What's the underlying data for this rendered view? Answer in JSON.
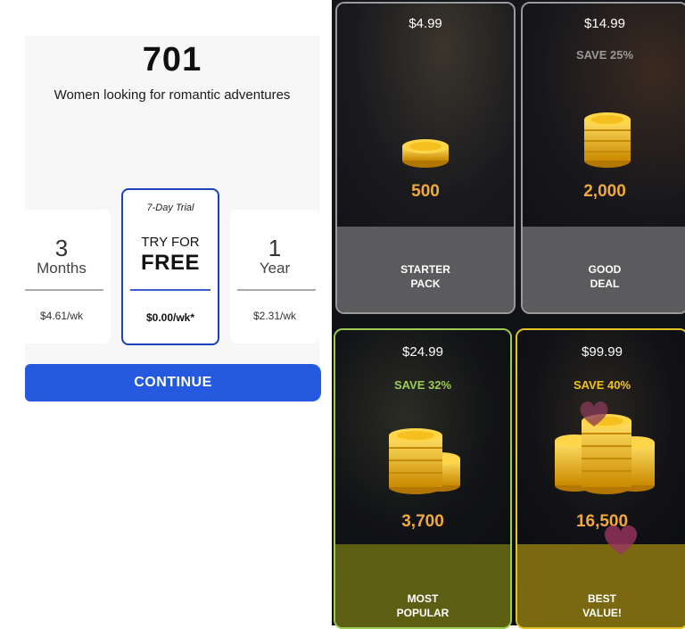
{
  "paywall": {
    "count": "701",
    "subtitle": "Women looking for romantic adventures",
    "plans": [
      {
        "number": "3",
        "unit": "Months",
        "price": "$4.61/wk"
      },
      {
        "tag": "7-Day Trial",
        "line1": "TRY FOR",
        "line2": "FREE",
        "price": "$0.00/wk*"
      },
      {
        "number": "1",
        "unit": "Year",
        "price": "$2.31/wk"
      }
    ],
    "continue_label": "CONTINUE",
    "accent_color": "#2459e0"
  },
  "shop": {
    "packs": [
      {
        "price": "$4.99",
        "save": "",
        "amount": "500",
        "label_line1": "STARTER",
        "label_line2": "PACK",
        "border_color": "#9a9a9a"
      },
      {
        "price": "$14.99",
        "save": "SAVE 25%",
        "amount": "2,000",
        "label_line1": "GOOD",
        "label_line2": "DEAL",
        "border_color": "#9a9a9a",
        "save_color": "#9a9a9a"
      },
      {
        "price": "$24.99",
        "save": "SAVE 32%",
        "amount": "3,700",
        "label_line1": "MOST",
        "label_line2": "POPULAR",
        "border_color": "#9ccc52",
        "save_color": "#9ccc52"
      },
      {
        "price": "$99.99",
        "save": "SAVE 40%",
        "amount": "16,500",
        "label_line1": "BEST",
        "label_line2": "VALUE!",
        "border_color": "#e6c226",
        "save_color": "#f0c419"
      }
    ],
    "amount_color": "#f2a93b",
    "icons": [
      "coin-stack-icon",
      "heart-icon"
    ]
  }
}
